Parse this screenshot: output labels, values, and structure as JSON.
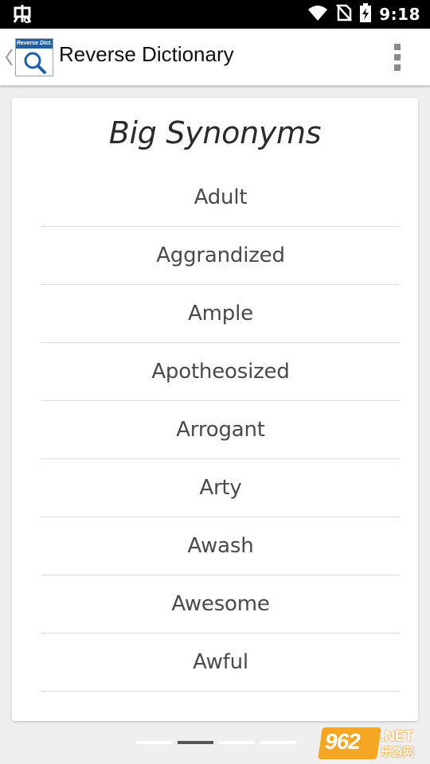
{
  "status_bar": {
    "time": "9:18",
    "icons": [
      "bug-icon",
      "wifi-icon",
      "no-sim-icon",
      "battery-charging-icon"
    ]
  },
  "app_bar": {
    "title": "Reverse Dictionary",
    "icon_label": "Reverse Dict.",
    "icons": [
      "back-chevron-icon",
      "search-magnifier-icon",
      "overflow-menu-icon"
    ]
  },
  "card": {
    "title": "Big Synonyms",
    "words": [
      "Adult",
      "Aggrandized",
      "Ample",
      "Apotheosized",
      "Arrogant",
      "Arty",
      "Awash",
      "Awesome",
      "Awful"
    ]
  },
  "pager": {
    "page_count": 4,
    "active_index": 1
  },
  "watermark": {
    "number": "962",
    "net": ".NET",
    "chinese": "乐游网"
  },
  "colors": {
    "background": "#efefef",
    "card": "#ffffff",
    "icon_accent": "#1f5fa8",
    "watermark": "#f5a623"
  }
}
